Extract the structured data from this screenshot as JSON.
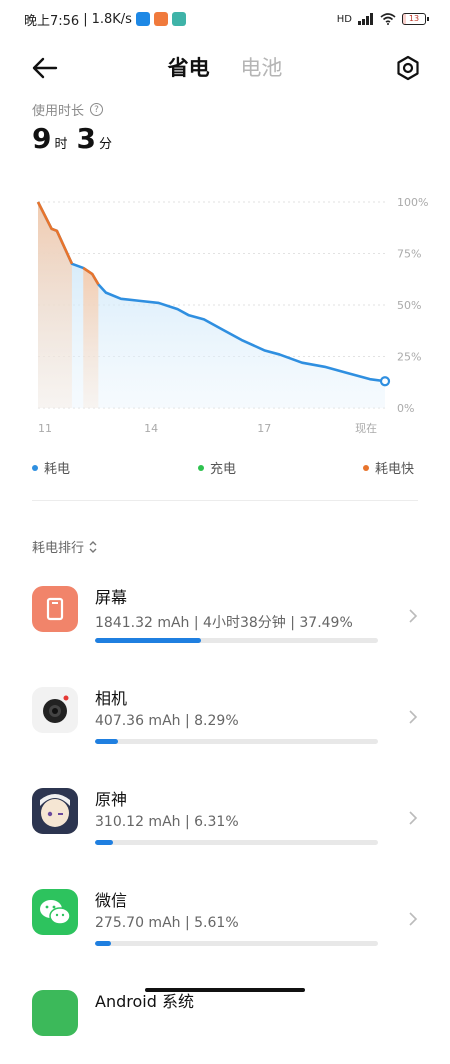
{
  "status_bar": {
    "time": "晚上7:56",
    "separator": "|",
    "speed": "1.8K/s",
    "network_label": "HD",
    "battery_level": "13"
  },
  "header": {
    "tabs": [
      {
        "label": "省电",
        "active": true
      },
      {
        "label": "电池",
        "active": false
      }
    ]
  },
  "usage": {
    "label": "使用时长",
    "hours": "9",
    "hours_unit": "时",
    "minutes": "3",
    "minutes_unit": "分"
  },
  "chart_data": {
    "type": "area",
    "y_ticks": [
      "100%",
      "75%",
      "50%",
      "25%",
      "0%"
    ],
    "x_ticks": [
      "11",
      "14",
      "17",
      "现在"
    ],
    "ylim": [
      0,
      100
    ],
    "points": [
      [
        0,
        100
      ],
      [
        0.18,
        87
      ],
      [
        0.25,
        86
      ],
      [
        0.45,
        70
      ],
      [
        0.6,
        68
      ],
      [
        0.72,
        65
      ],
      [
        0.8,
        60
      ],
      [
        0.9,
        56
      ],
      [
        1.1,
        53
      ],
      [
        1.35,
        52
      ],
      [
        1.6,
        51
      ],
      [
        1.85,
        48
      ],
      [
        2.0,
        45
      ],
      [
        2.2,
        43
      ],
      [
        2.45,
        38
      ],
      [
        2.7,
        33
      ],
      [
        3.0,
        28
      ],
      [
        3.2,
        26
      ],
      [
        3.5,
        22
      ],
      [
        3.8,
        20
      ],
      [
        4.1,
        17
      ],
      [
        4.4,
        14
      ],
      [
        4.6,
        13
      ]
    ],
    "fast_spans": [
      [
        0,
        0.45
      ],
      [
        0.6,
        0.8
      ]
    ],
    "x_tick_pos": [
      0,
      1.5,
      3.0,
      4.35
    ],
    "colors": {
      "line": "#2f8fe0",
      "fast": "#e8742c",
      "charge": "#2ec24f"
    }
  },
  "legend": [
    {
      "label": "耗电",
      "color": "#2f8fe0"
    },
    {
      "label": "充电",
      "color": "#2ec24f"
    },
    {
      "label": "耗电快",
      "color": "#e8742c"
    }
  ],
  "ranking": {
    "title": "耗电排行",
    "items": [
      {
        "name": "屏幕",
        "detail": "1841.32 mAh | 4小时38分钟 | 37.49%",
        "percent": 37.49,
        "icon": "screen-icon"
      },
      {
        "name": "相机",
        "detail": "407.36 mAh | 8.29%",
        "percent": 8.29,
        "icon": "camera-icon"
      },
      {
        "name": "原神",
        "detail": "310.12 mAh | 6.31%",
        "percent": 6.31,
        "icon": "genshin-icon"
      },
      {
        "name": "微信",
        "detail": "275.70 mAh | 5.61%",
        "percent": 5.61,
        "icon": "wechat-icon"
      },
      {
        "name": "Android 系统",
        "detail": "",
        "percent": 0,
        "icon": "android-icon"
      }
    ]
  }
}
